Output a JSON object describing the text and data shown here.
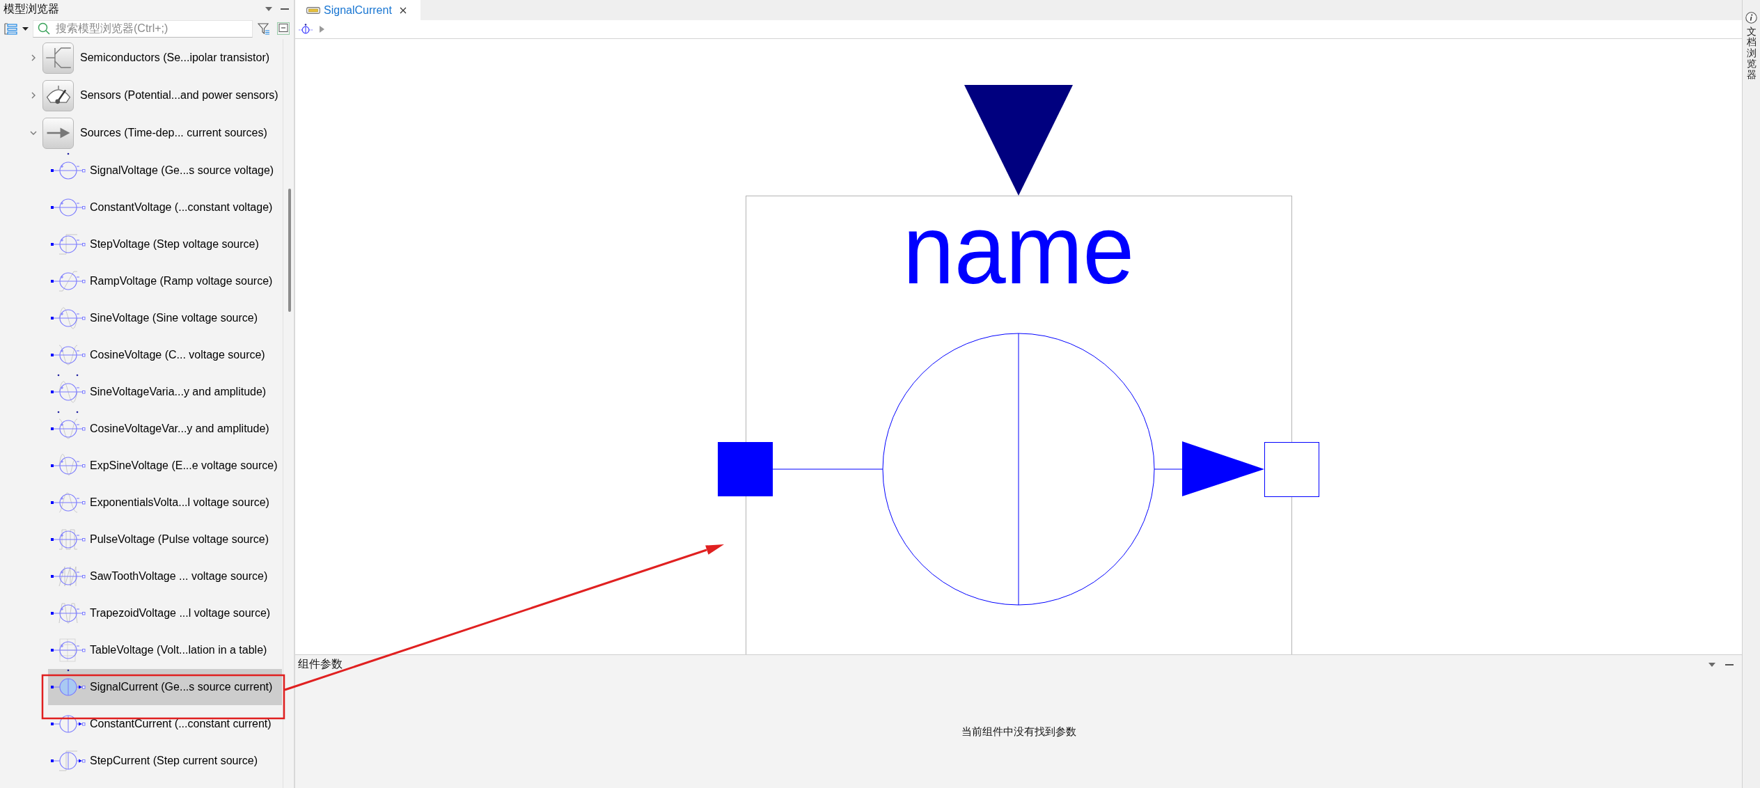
{
  "model_browser": {
    "title": "模型浏览器",
    "search": {
      "placeholder": "搜索模型浏览器(Ctrl+;)"
    },
    "tree": [
      {
        "label": "Semiconductors (Se...ipolar transistor)",
        "expanded": false,
        "selected": false
      },
      {
        "label": "Sensors (Potential...and power sensors)",
        "expanded": false,
        "selected": false
      },
      {
        "label": "Sources (Time-dep... current sources)",
        "expanded": true,
        "selected": false,
        "children": [
          {
            "label": "SignalVoltage (Ge...s source voltage)",
            "selected": false
          },
          {
            "label": "ConstantVoltage (...constant voltage)",
            "selected": false
          },
          {
            "label": "StepVoltage (Step voltage source)",
            "selected": false
          },
          {
            "label": "RampVoltage (Ramp voltage source)",
            "selected": false
          },
          {
            "label": "SineVoltage (Sine voltage source)",
            "selected": false
          },
          {
            "label": "CosineVoltage (C... voltage source)",
            "selected": false
          },
          {
            "label": "SineVoltageVaria...y and amplitude)",
            "selected": false
          },
          {
            "label": "CosineVoltageVar...y and amplitude)",
            "selected": false
          },
          {
            "label": "ExpSineVoltage (E...e voltage source)",
            "selected": false
          },
          {
            "label": "ExponentialsVolta...l voltage source)",
            "selected": false
          },
          {
            "label": "PulseVoltage (Pulse voltage source)",
            "selected": false
          },
          {
            "label": "SawToothVoltage ... voltage source)",
            "selected": false
          },
          {
            "label": "TrapezoidVoltage ...l voltage source)",
            "selected": false
          },
          {
            "label": "TableVoltage (Volt...lation in a table)",
            "selected": false
          },
          {
            "label": "SignalCurrent (Ge...s source current)",
            "selected": true
          },
          {
            "label": "ConstantCurrent (...constant current)",
            "selected": false
          },
          {
            "label": "StepCurrent (Step current source)",
            "selected": false
          }
        ]
      }
    ]
  },
  "editor": {
    "tabs": [
      {
        "label": "SignalCurrent",
        "selected": true
      }
    ],
    "diagram": {
      "name_label": "name"
    }
  },
  "parameters_panel": {
    "title": "组件参数",
    "message": "当前组件中没有找到参数"
  },
  "documentation_panel": {
    "title": "文档浏览器"
  }
}
